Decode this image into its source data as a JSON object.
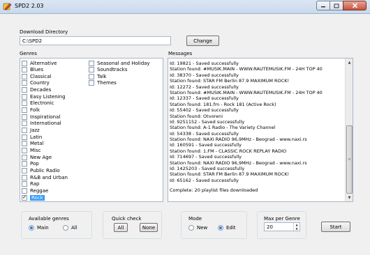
{
  "window": {
    "title": "SPD2 2.03",
    "buttons": [
      "minimize",
      "maximize",
      "close"
    ]
  },
  "download": {
    "label": "Download Directory",
    "value": "C:\\SPD2",
    "change_label": "Change"
  },
  "genres": {
    "label": "Genres",
    "items_col1": [
      {
        "label": "Alternative",
        "checked": false
      },
      {
        "label": "Blues",
        "checked": false
      },
      {
        "label": "Classical",
        "checked": false
      },
      {
        "label": "Country",
        "checked": false
      },
      {
        "label": "Decades",
        "checked": false
      },
      {
        "label": "Easy Listening",
        "checked": false
      },
      {
        "label": "Electronic",
        "checked": false
      },
      {
        "label": "Folk",
        "checked": false
      },
      {
        "label": "Inspirational",
        "checked": false
      },
      {
        "label": "International",
        "checked": false
      },
      {
        "label": "Jazz",
        "checked": false
      },
      {
        "label": "Latin",
        "checked": false
      },
      {
        "label": "Metal",
        "checked": false
      },
      {
        "label": "Misc",
        "checked": false
      },
      {
        "label": "New Age",
        "checked": false
      },
      {
        "label": "Pop",
        "checked": false
      },
      {
        "label": "Public Radio",
        "checked": false
      },
      {
        "label": "R&B and Urban",
        "checked": false
      },
      {
        "label": "Rap",
        "checked": false
      },
      {
        "label": "Reggae",
        "checked": false
      },
      {
        "label": "Rock",
        "checked": true,
        "selected": true
      }
    ],
    "items_col2": [
      {
        "label": "Seasonal and Holiday",
        "checked": false
      },
      {
        "label": "Soundtracks",
        "checked": false
      },
      {
        "label": "Talk",
        "checked": false
      },
      {
        "label": "Themes",
        "checked": false
      }
    ]
  },
  "messages": {
    "label": "Messages",
    "lines": [
      "Id: 19821 - Saved successfully",
      "Station found: #MUSIK.MAIN - WWW.RAUTEMUSIK.FM - 24H TOP 40",
      "Id: 38370 - Saved successfully",
      "Station found: STAR FM Berlin 87.9  MAXIMUM ROCK!",
      "Id: 12272 - Saved successfully",
      "Station found: #MUSIK.MAIN - WWW.RAUTEMUSIK.FM - 24H TOP 40",
      "Id: 12337 - Saved successfully",
      "Station found: 181.fm - Rock 181 (Active Rock)",
      "Id: 55402 - Saved successfully",
      "Station found: Otvoreni",
      "Id: 9251152 - Saved successfully",
      "Station found: A-1 Radio - The Variety Channel",
      "Id: 54338 - Saved successfully",
      "Station found: NAXI RADIO 96,9MHz - Beograd - www.naxi.rs",
      "Id: 160591 - Saved successfully",
      "Station found: 1.FM - CLASSIC ROCK REPLAY RADIO",
      "Id: 714697 - Saved successfully",
      "Station found: NAXI RADIO 96,9MHz - Beograd - www.naxi.rs",
      "Id: 1425203 - Saved successfully",
      "Station found: STAR FM Berlin 87.9  MAXIMUM ROCK!",
      "Id: 65162 - Saved successfully"
    ],
    "footer": "Complete: 20 playlist files downloaded"
  },
  "available_genres": {
    "label": "Available genres",
    "options": [
      "Main",
      "All"
    ],
    "selected": "Main"
  },
  "quick_check": {
    "label": "Quick check",
    "all_label": "All",
    "none_label": "None"
  },
  "mode": {
    "label": "Mode",
    "options": [
      "New",
      "Edit"
    ],
    "selected": "Edit"
  },
  "max_per_genre": {
    "label": "Max per Genre",
    "value": "20"
  },
  "start_label": "Start",
  "colors": {
    "selection": "#3399ff",
    "radio_dot": "#2a7ae2"
  }
}
